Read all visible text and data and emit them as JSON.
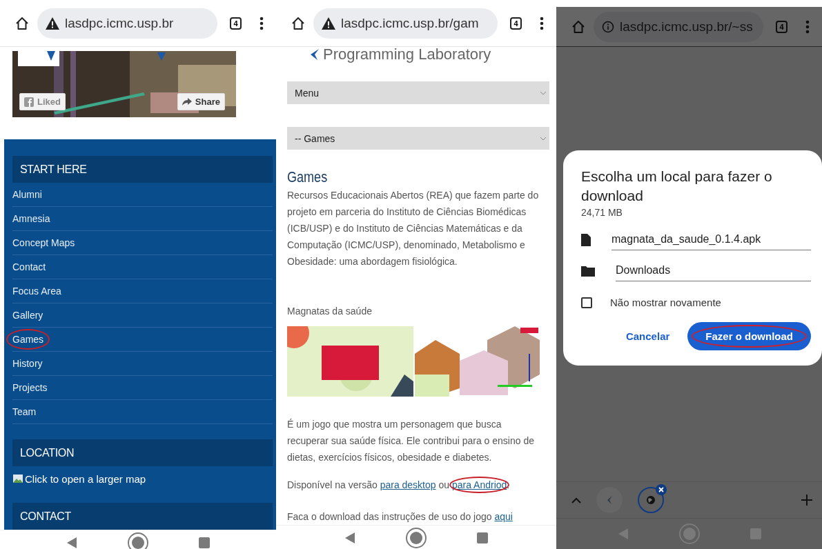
{
  "left_screen": {
    "browser_bar": {
      "insecure": true,
      "url": "lasdpc.icmc.usp.br",
      "tab_count": "4"
    },
    "banner": {
      "kind": "picture",
      "liked_label": "Liked",
      "share_label": "Share"
    },
    "sidebar": [
      {
        "kind": "nav",
        "title": "START HERE",
        "items": [
          {
            "label": "Alumni",
            "circled": false
          },
          {
            "label": "Amnesia",
            "circled": false
          },
          {
            "label": "Concept Maps",
            "circled": false
          },
          {
            "label": "Contact",
            "circled": false
          },
          {
            "label": "Focus Area",
            "circled": false
          },
          {
            "label": "Gallery",
            "circled": false
          },
          {
            "label": "Games",
            "circled": true
          },
          {
            "label": "History",
            "circled": false
          },
          {
            "label": "Projects",
            "circled": false
          },
          {
            "label": "Team",
            "circled": false
          }
        ]
      },
      {
        "kind": "map",
        "title": "LOCATION",
        "link": "Click to open a larger map"
      },
      {
        "kind": "header",
        "title": "CONTACT"
      }
    ]
  },
  "middle_screen": {
    "browser_bar": {
      "insecure": true,
      "url": "lasdpc.icmc.usp.br/gam",
      "tab_count": "4"
    },
    "logo_text": "Programming Laboratory",
    "selects": [
      "Menu",
      "-- Games"
    ],
    "heading": "Games",
    "intro": "Recursos Educacionais Abertos (REA) que fazem parte do projeto em parceria do Instituto de Ciências Biomédicas (ICB/USP) e do Instituto de Ciências Matemáticas e da Computação (ICMC/USP), denominado, Metabolismo e Obesidade: uma abordagem fisiológica.",
    "game_title": "Magnatas da saúde",
    "game_image": {
      "kind": "picture"
    },
    "description": "É um jogo que mostra um personagem que busca recuperar sua saúde física. Ele contribui para o ensino de dietas, exercícios físicos, obesidade e diabetes.",
    "availability": [
      {
        "kind": "text",
        "text": "Disponível na versão "
      },
      {
        "kind": "link",
        "text": "para desktop",
        "circled": false
      },
      {
        "kind": "text",
        "text": " ou "
      },
      {
        "kind": "link",
        "text": "para Andriod",
        "circled": true
      },
      {
        "kind": "text",
        "text": "."
      }
    ],
    "instructions": [
      {
        "kind": "text",
        "text": "Faca o download das instruções de uso do jogo "
      },
      {
        "kind": "link",
        "text": "aqui",
        "circled": false
      }
    ]
  },
  "right_screen": {
    "browser_bar": {
      "insecure": false,
      "url": "lasdpc.icmc.usp.br/~ss",
      "tab_count": "4"
    },
    "dialog": {
      "title": "Escolha um local para fazer o download",
      "size": "24,71 MB",
      "fields": [
        {
          "kind": "file",
          "value": "magnata_da_saude_0.1.4.apk"
        },
        {
          "kind": "folder",
          "value": "Downloads"
        }
      ],
      "checkbox": {
        "label": "Não mostrar novamente",
        "checked": false
      },
      "buttons": [
        {
          "kind": "text",
          "label": "Cancelar",
          "circled": false
        },
        {
          "kind": "filled",
          "label": "Fazer o download",
          "circled": true
        }
      ]
    },
    "tab_strip": {
      "tabs": [
        {
          "selected": false
        },
        {
          "selected": true
        }
      ]
    }
  }
}
